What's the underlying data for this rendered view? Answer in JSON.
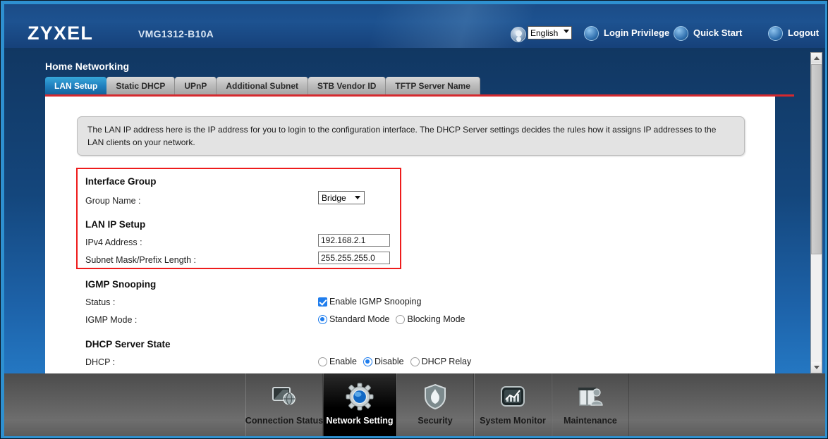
{
  "header": {
    "logo": "ZYXEL",
    "model": "VMG1312-B10A",
    "language": {
      "selected": "English",
      "icon": "user-avatar-icon"
    },
    "links": [
      {
        "label": "Login Privilege",
        "icon": "users-icon"
      },
      {
        "label": "Quick Start",
        "icon": "wizard-wand-icon"
      },
      {
        "label": "Logout",
        "icon": "logout-icon"
      }
    ]
  },
  "page": {
    "title": "Home Networking",
    "tabs": [
      {
        "label": "LAN Setup",
        "active": true
      },
      {
        "label": "Static DHCP",
        "active": false
      },
      {
        "label": "UPnP",
        "active": false
      },
      {
        "label": "Additional Subnet",
        "active": false
      },
      {
        "label": "STB Vendor ID",
        "active": false
      },
      {
        "label": "TFTP Server Name",
        "active": false
      }
    ],
    "accent_red": "#d5292e",
    "highlight_red": "#ee1c1c"
  },
  "info": {
    "text": "The LAN IP address here is the IP address for you to login to the configuration interface. The DHCP Server settings decides the rules how it assigns IP addresses to the LAN clients on your network."
  },
  "form": {
    "interface_group": {
      "title": "Interface Group",
      "group_name_label": "Group Name :",
      "group_name_value": "Bridge"
    },
    "lan_ip_setup": {
      "title": "LAN IP Setup",
      "ipv4_label": "IPv4 Address :",
      "ipv4_value": "192.168.2.1",
      "subnet_label": "Subnet Mask/Prefix Length :",
      "subnet_value": "255.255.255.0"
    },
    "igmp_snooping": {
      "title": "IGMP Snooping",
      "status_label": "Status :",
      "status_checkbox_label": "Enable IGMP Snooping",
      "status_checked": true,
      "mode_label": "IGMP Mode :",
      "mode_options": [
        {
          "label": "Standard Mode",
          "selected": true
        },
        {
          "label": "Blocking Mode",
          "selected": false
        }
      ]
    },
    "dhcp_server_state": {
      "title": "DHCP Server State",
      "dhcp_label": "DHCP :",
      "dhcp_options": [
        {
          "label": "Enable",
          "selected": false
        },
        {
          "label": "Disable",
          "selected": true
        },
        {
          "label": "DHCP Relay",
          "selected": false
        }
      ]
    }
  },
  "bottom_nav": [
    {
      "label": "Connection Status",
      "icon": "monitor-globe-icon",
      "active": false
    },
    {
      "label": "Network Setting",
      "icon": "gear-icon",
      "active": true
    },
    {
      "label": "Security",
      "icon": "shield-flame-icon",
      "active": false
    },
    {
      "label": "System Monitor",
      "icon": "chart-monitor-icon",
      "active": false
    },
    {
      "label": "Maintenance",
      "icon": "toolbox-user-icon",
      "active": false
    }
  ]
}
